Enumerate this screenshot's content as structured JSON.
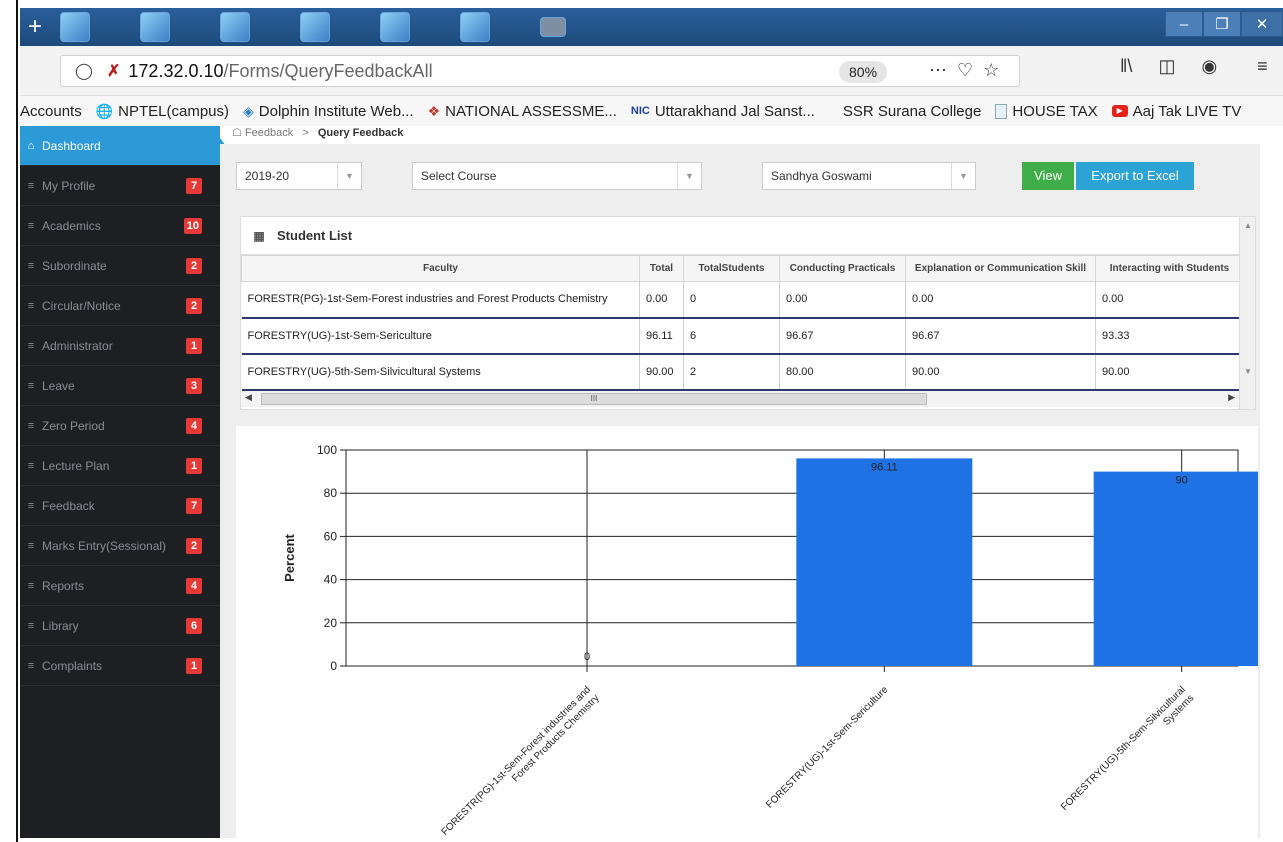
{
  "browser": {
    "url_host": "172.32.0.10",
    "url_path": "/Forms/QueryFeedbackAll",
    "zoom": "80%",
    "bookmarks": [
      {
        "label": "Accounts",
        "icon": "none-icon"
      },
      {
        "label": "NPTEL(campus)",
        "icon": "globe-icon"
      },
      {
        "label": "Dolphin Institute Web...",
        "icon": "dolphin-icon"
      },
      {
        "label": "NATIONAL ASSESSME...",
        "icon": "naac-icon"
      },
      {
        "label": "Uttarakhand Jal Sanst...",
        "icon": "nic-icon"
      },
      {
        "label": "SSR Surana College",
        "icon": "none-icon"
      },
      {
        "label": "HOUSE TAX",
        "icon": "document-icon"
      },
      {
        "label": "Aaj Tak LIVE TV",
        "icon": "youtube-icon"
      }
    ]
  },
  "breadcrumb": {
    "parent": "Feedback",
    "separator": ">",
    "current": "Query Feedback"
  },
  "sidebar": {
    "items": [
      {
        "label": "Dashboard",
        "badge": "",
        "active": true
      },
      {
        "label": "My Profile",
        "badge": "7"
      },
      {
        "label": "Academics",
        "badge": "10"
      },
      {
        "label": "Subordinate",
        "badge": "2"
      },
      {
        "label": "Circular/Notice",
        "badge": "2"
      },
      {
        "label": "Administrator",
        "badge": "1"
      },
      {
        "label": "Leave",
        "badge": "3"
      },
      {
        "label": "Zero Period",
        "badge": "4"
      },
      {
        "label": "Lecture Plan",
        "badge": "1"
      },
      {
        "label": "Feedback",
        "badge": "7"
      },
      {
        "label": "Marks Entry(Sessional)",
        "badge": "2"
      },
      {
        "label": "Reports",
        "badge": "4"
      },
      {
        "label": "Library",
        "badge": "6"
      },
      {
        "label": "Complaints",
        "badge": "1"
      }
    ]
  },
  "filters": {
    "session": "2019-20",
    "course": "Select Course",
    "faculty": "Sandhya Goswami",
    "view_label": "View",
    "export_label": "Export to Excel"
  },
  "grid": {
    "title": "Student List",
    "columns": [
      "Faculty",
      "Total",
      "TotalStudents",
      "Conducting Practicals",
      "Explanation or Communication Skill",
      "Interacting with Students"
    ],
    "rows": [
      [
        "FORESTR(PG)-1st-Sem-Forest industries and Forest Products Chemistry",
        "0.00",
        "0",
        "0.00",
        "0.00",
        "0.00"
      ],
      [
        "FORESTRY(UG)-1st-Sem-Sericulture",
        "96.11",
        "6",
        "96.67",
        "96.67",
        "93.33"
      ],
      [
        "FORESTRY(UG)-5th-Sem-Silvicultural Systems",
        "90.00",
        "2",
        "80.00",
        "90.00",
        "90.00"
      ]
    ],
    "scroll_grip": "III"
  },
  "chart_data": {
    "type": "bar",
    "categories": [
      "FORESTR(PG)-1st-Sem-Forest industries and Forest Products Chemistry",
      "FORESTRY(UG)-1st-Sem-Sericulture",
      "FORESTRY(UG)-5th-Sem-Silvicultural Systems"
    ],
    "values": [
      0,
      96.11,
      90
    ],
    "data_labels": [
      "0",
      "96.11",
      "90"
    ],
    "title": "",
    "xlabel": "",
    "ylabel": "Percent",
    "ylim": [
      0,
      100
    ],
    "yticks": [
      0,
      20,
      40,
      60,
      80,
      100
    ],
    "bar_color": "#1f72e3",
    "grid": true,
    "legend": "none"
  },
  "colors": {
    "sidebar_bg": "#1e1f23",
    "active_item": "#2b9ad6",
    "badge": "#e53935",
    "view_button": "#3fae49",
    "export_button": "#2ba3d4"
  }
}
